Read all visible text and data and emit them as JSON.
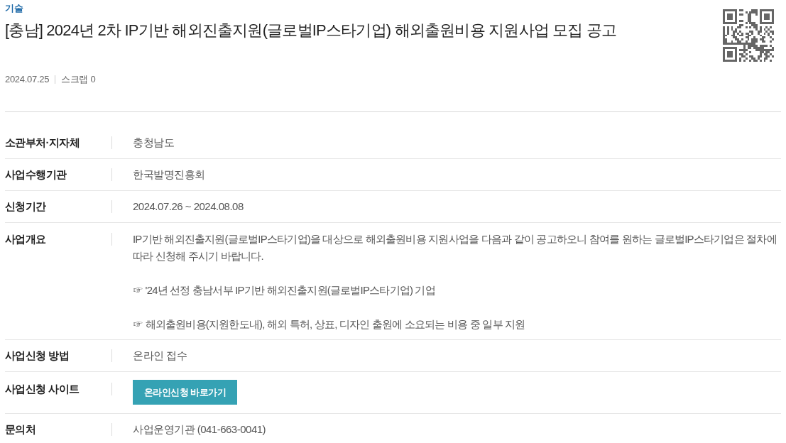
{
  "category": "기술",
  "title": "[충남] 2024년 2차 IP기반 해외진출지원(글로벌IP스타기업) 해외출원비용 지원사업 모집 공고",
  "meta": {
    "date": "2024.07.25",
    "scrap": "스크랩 0"
  },
  "fields": [
    {
      "kind": "text",
      "label": "소관부처·지자체",
      "value": "충청남도"
    },
    {
      "kind": "text",
      "label": "사업수행기관",
      "value": "한국발명진흥회"
    },
    {
      "kind": "text",
      "label": "신청기간",
      "value": "2024.07.26 ~ 2024.08.08"
    },
    {
      "kind": "paragraphs",
      "label": "사업개요",
      "paragraphs": [
        "IP기반 해외진출지원(글로벌IP스타기업)을 대상으로 해외출원비용 지원사업을 다음과 같이 공고하오니 참여를 원하는 글로벌IP스타기업은 절차에 따라 신청해 주시기 바랍니다.",
        "☞ '24년 선정 충남서부 IP기반 해외진출지원(글로벌IP스타기업) 기업",
        "☞ 해외출원비용(지원한도내), 해외 특허, 상표, 디자인 출원에 소요되는 비용 중 일부 지원"
      ]
    },
    {
      "kind": "text",
      "label": "사업신청 방법",
      "value": "온라인 접수"
    },
    {
      "kind": "button",
      "label": "사업신청 사이트",
      "button": "온라인신청 바로가기"
    },
    {
      "kind": "text",
      "label": "문의처",
      "value": "사업운영기관 (041-663-0041)"
    }
  ]
}
